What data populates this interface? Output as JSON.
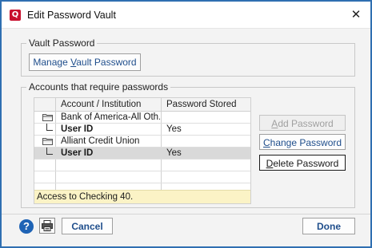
{
  "window": {
    "title": "Edit Password Vault",
    "app_icon": "quicken-q-icon",
    "app_icon_letter": "Q",
    "close_glyph": "✕"
  },
  "vault_group": {
    "legend": "Vault Password",
    "manage_pre": "Manage ",
    "manage_mnemonic": "V",
    "manage_post": "ault Password"
  },
  "accounts_group": {
    "legend": "Accounts that require passwords",
    "columns": [
      "Account / Institution",
      "Password Stored"
    ],
    "rows": [
      {
        "type": "institution",
        "name": "Bank of America-All Oth...",
        "stored": ""
      },
      {
        "type": "field",
        "name": "User ID",
        "stored": "Yes"
      },
      {
        "type": "institution",
        "name": "Alliant Credit Union",
        "stored": ""
      },
      {
        "type": "field",
        "name": "User ID",
        "stored": "Yes"
      }
    ],
    "status_text": "Access to Checking 40.",
    "add_mnemonic": "A",
    "add_post": "dd Password",
    "change_mnemonic": "C",
    "change_post": "hange Password",
    "delete_mnemonic": "D",
    "delete_post": "elete Password"
  },
  "footer": {
    "help_glyph": "?",
    "cancel_label": "Cancel",
    "done_label": "Done"
  },
  "colors": {
    "border": "#2f6fb1",
    "link_text": "#1f4e8c",
    "status_bg": "#fbf3c6",
    "selected_row": "#d9d9d9"
  }
}
